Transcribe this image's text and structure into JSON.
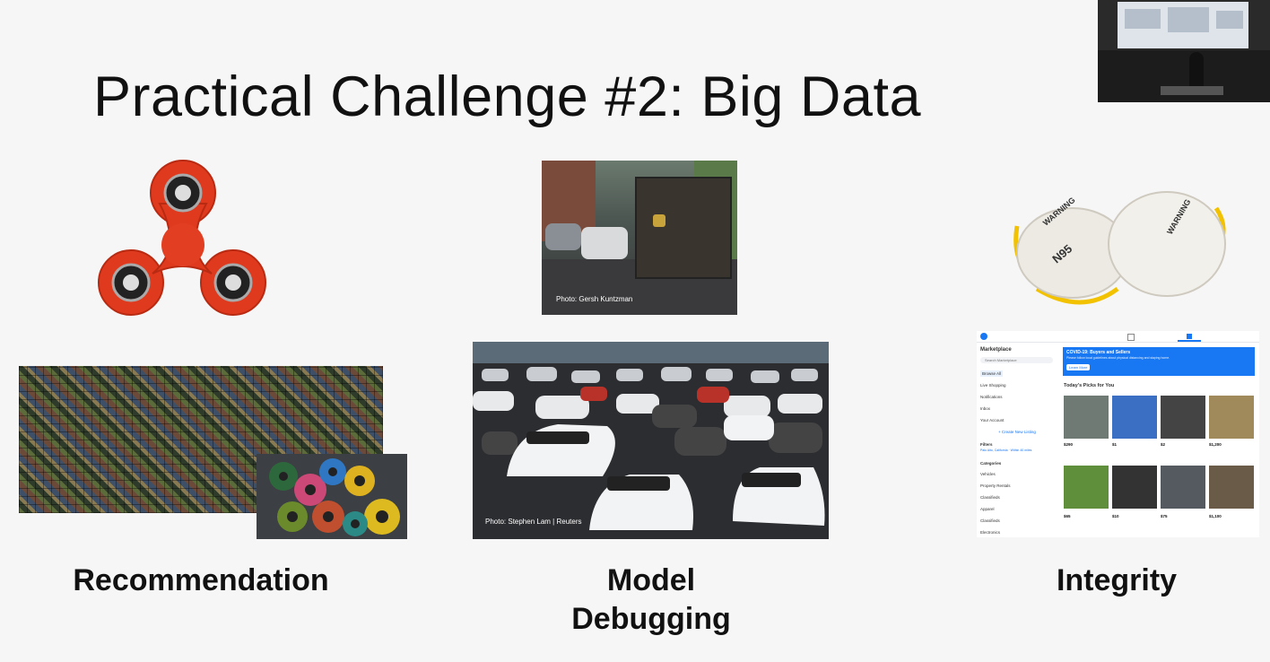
{
  "slide": {
    "title": "Practical Challenge #2: Big Data",
    "captions": {
      "recommendation": "Recommendation",
      "model_debugging": "Model\nDebugging",
      "integrity": "Integrity"
    },
    "credits": {
      "truck": "Photo: Gersh Kuntzman",
      "cars": "Photo: Stephen Lam | Reuters"
    }
  },
  "marketplace": {
    "title": "Marketplace",
    "search_placeholder": "Search Marketplace",
    "sidebar": [
      "Browse All",
      "Live Shopping",
      "Notifications",
      "Inbox",
      "Your Account"
    ],
    "create_listing": "+ Create New Listing",
    "filters_label": "Filters",
    "location": "Palo Alto, California · Within 40 miles",
    "categories_label": "Categories",
    "categories": [
      "Vehicles",
      "Property Rentals",
      "Classifieds",
      "Apparel",
      "Classifieds",
      "Electronics"
    ],
    "banner_title": "COVID-19: Buyers and Sellers",
    "banner_text": "Please follow local guidelines about physical distancing and staying home.",
    "banner_button": "Learn More",
    "picks_label": "Today's Picks for You",
    "prices": [
      "$290",
      "$1",
      "$2",
      "$1,200",
      "$65",
      "$10",
      "$75",
      "$1,100"
    ],
    "accent": "#1877f2"
  },
  "colors": {
    "background": "#f6f6f6",
    "spinner_red": "#e03a1e"
  }
}
